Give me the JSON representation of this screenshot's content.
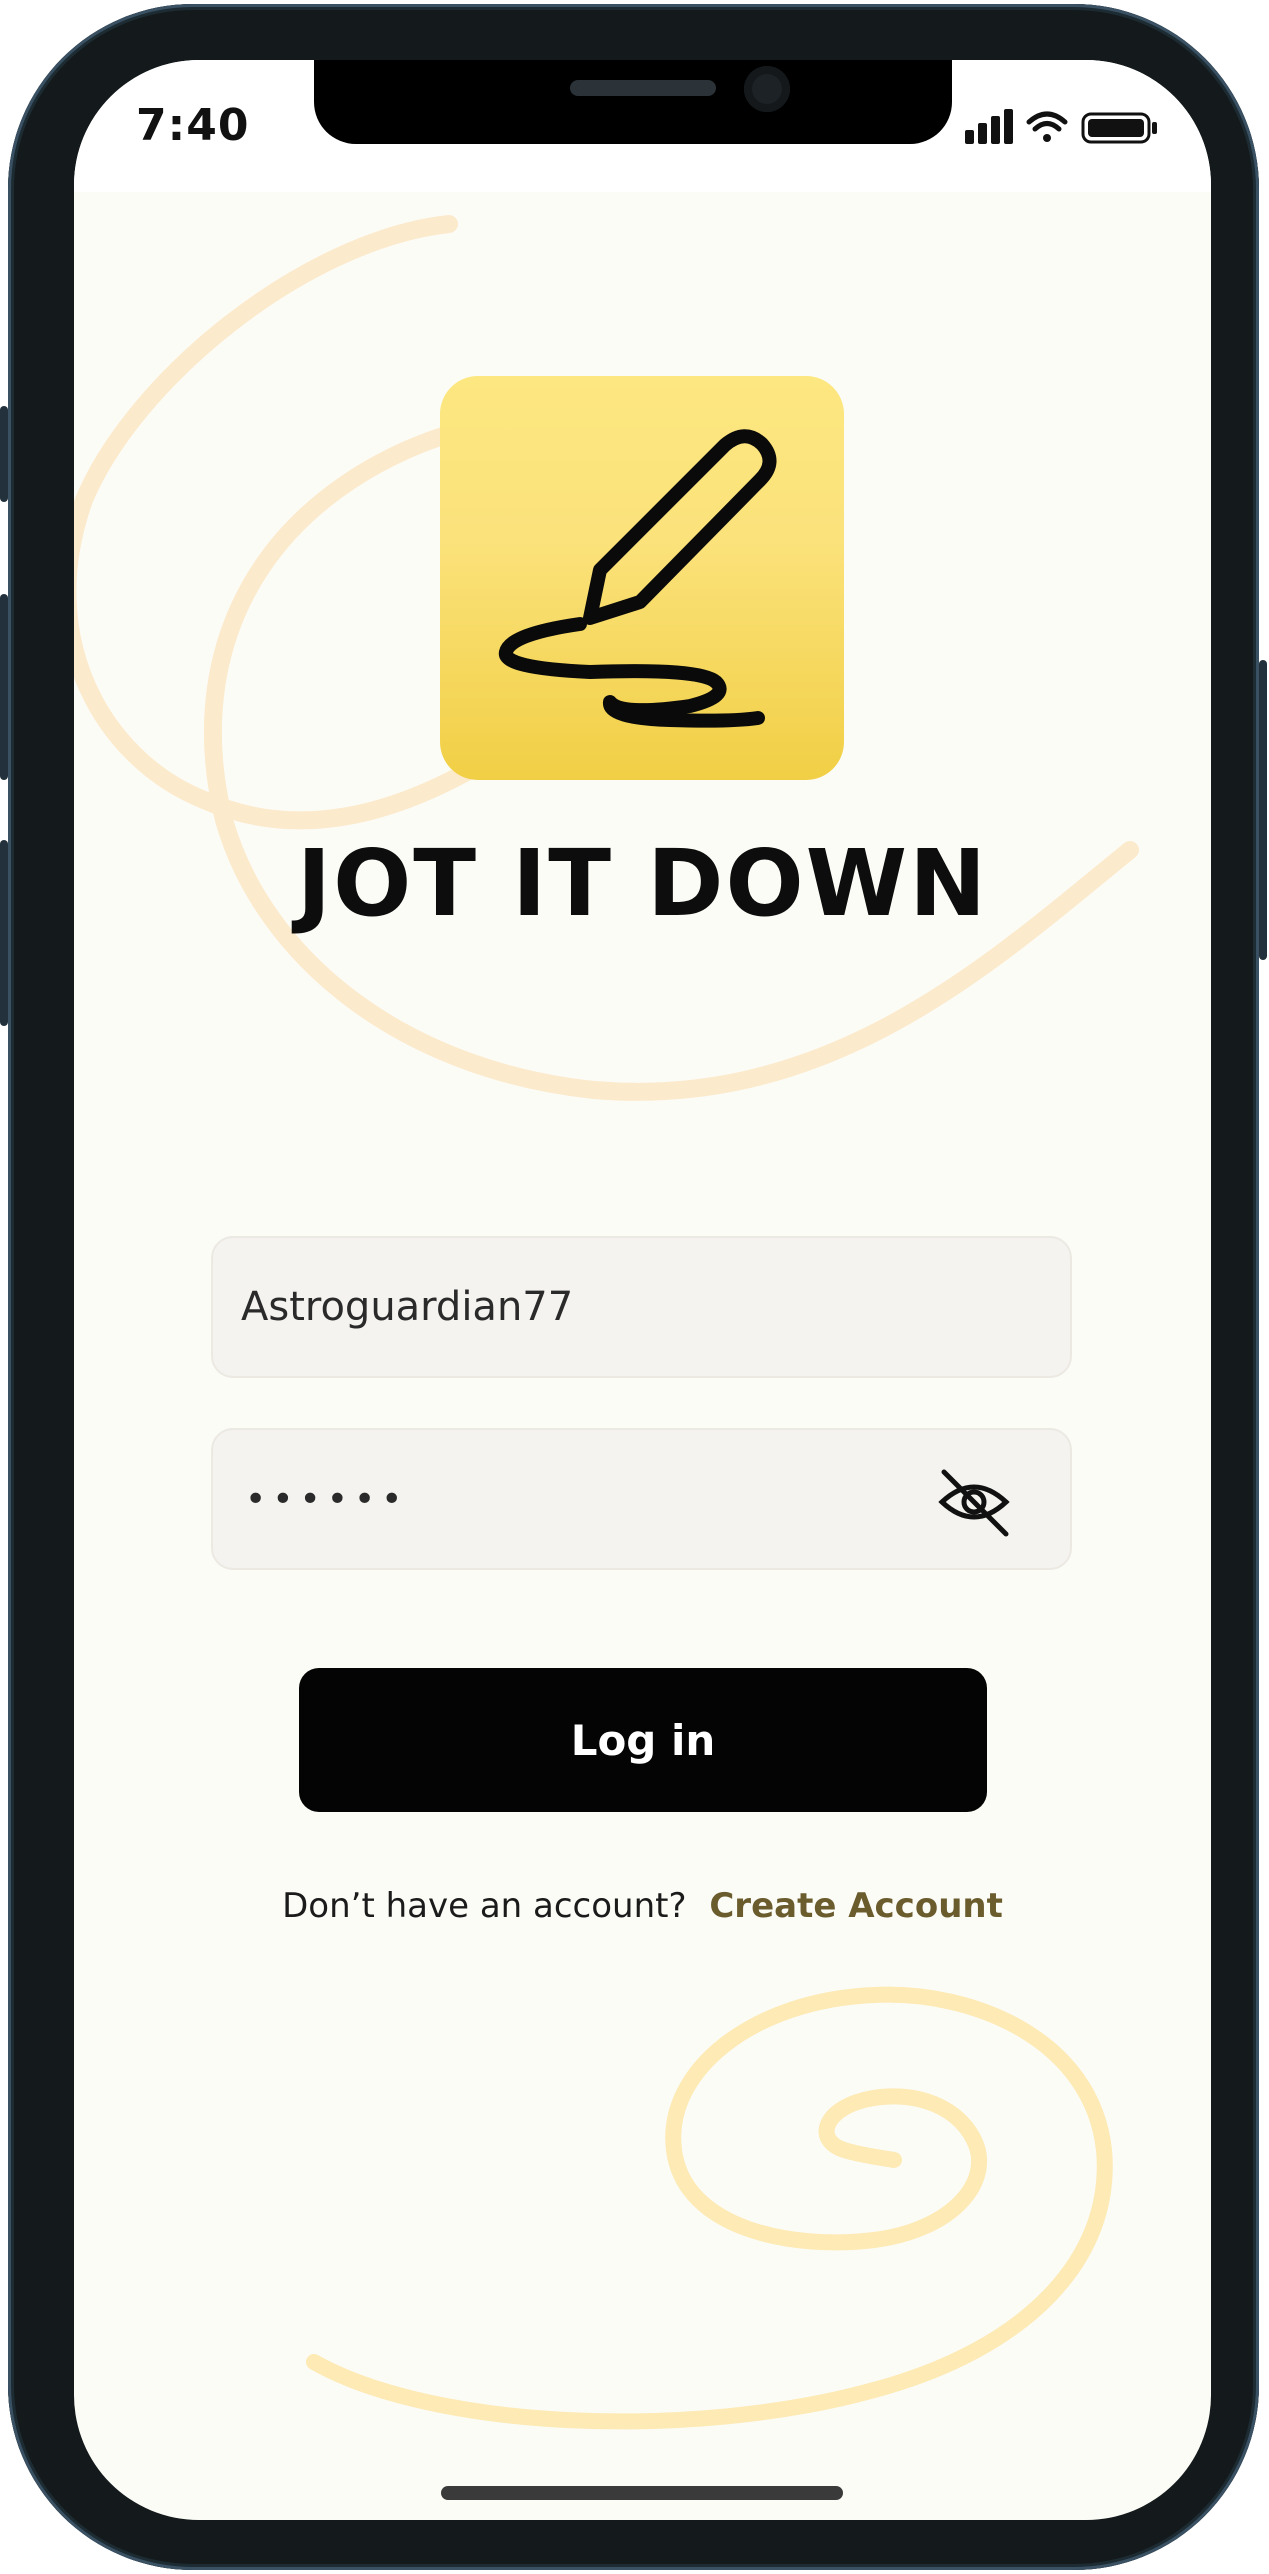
{
  "status_bar": {
    "time": "7:40",
    "icons": [
      "cellular-signal-icon",
      "wifi-icon",
      "battery-icon"
    ]
  },
  "app": {
    "icon_name": "pen-scribble-icon",
    "title": "JOT IT DOWN"
  },
  "login_form": {
    "username_value": "Astroguardian77",
    "password_masked": "••••••",
    "password_toggle_icon": "eye-slash-icon",
    "login_label": "Log in"
  },
  "signup": {
    "prompt": "Don’t have an account?",
    "link_label": "Create Account"
  },
  "colors": {
    "background": "#fcfcf7",
    "accent_yellow": "#f8dc5e",
    "swirl": "#fbe6b8",
    "button": "#040404",
    "link": "#6b5c2e"
  }
}
